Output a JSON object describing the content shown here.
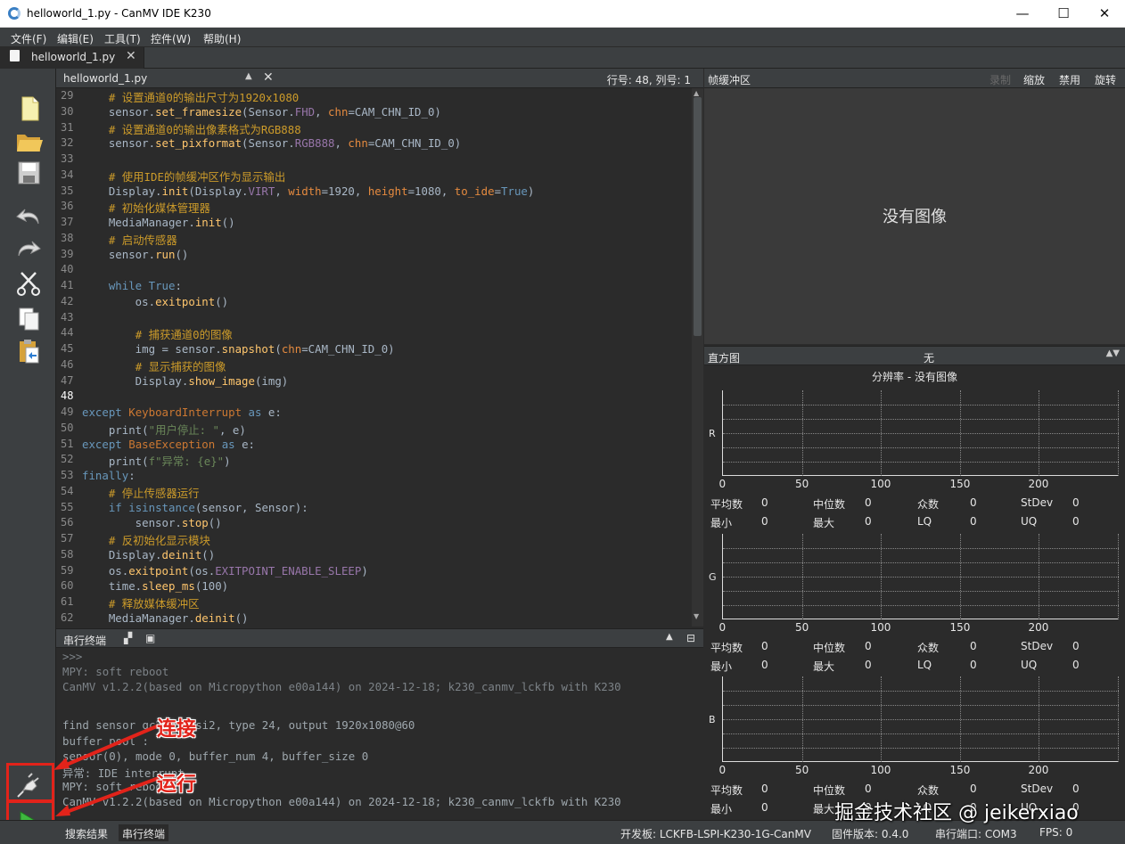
{
  "window": {
    "title": "helloworld_1.py - CanMV IDE K230",
    "minimize": "—",
    "maximize": "☐",
    "close": "✕"
  },
  "menu": [
    "文件(F)",
    "编辑(E)",
    "工具(T)",
    "控件(W)",
    "帮助(H)"
  ],
  "doc_tab": {
    "name": "helloworld_1.py",
    "close": "✕"
  },
  "editor": {
    "file": "helloworld_1.py",
    "position": "行号: 48, 列号: 1",
    "current_line": 48,
    "line_numbers": [
      "29",
      "30",
      "31",
      "32",
      "33",
      "34",
      "35",
      "36",
      "37",
      "38",
      "39",
      "40",
      "41",
      "42",
      "43",
      "44",
      "45",
      "46",
      "47",
      "48",
      "49",
      "50",
      "51",
      "52",
      "53",
      "54",
      "55",
      "56",
      "57",
      "58",
      "59",
      "60",
      "61",
      "62"
    ],
    "lines": [
      "    # 设置通道0的输出尺寸为1920x1080",
      "    sensor.set_framesize(Sensor.FHD, chn=CAM_CHN_ID_0)",
      "    # 设置通道0的输出像素格式为RGB888",
      "    sensor.set_pixformat(Sensor.RGB888, chn=CAM_CHN_ID_0)",
      "",
      "    # 使用IDE的帧缓冲区作为显示输出",
      "    Display.init(Display.VIRT, width=1920, height=1080, to_ide=True)",
      "    # 初始化媒体管理器",
      "    MediaManager.init()",
      "    # 启动传感器",
      "    sensor.run()",
      "",
      "    while True:",
      "        os.exitpoint()",
      "",
      "        # 捕获通道0的图像",
      "        img = sensor.snapshot(chn=CAM_CHN_ID_0)",
      "        # 显示捕获的图像",
      "        Display.show_image(img)",
      "",
      "except KeyboardInterrupt as e:",
      "    print(\"用户停止: \", e)",
      "except BaseException as e:",
      "    print(f\"异常: {e}\")",
      "finally:",
      "    # 停止传感器运行",
      "    if isinstance(sensor, Sensor):",
      "        sensor.stop()",
      "    # 反初始化显示模块",
      "    Display.deinit()",
      "    os.exitpoint(os.EXITPOINT_ENABLE_SLEEP)",
      "    time.sleep_ms(100)",
      "    # 释放媒体缓冲区",
      "    MediaManager.deinit()"
    ]
  },
  "terminal": {
    "title": "串行终端",
    "lines": [
      ">>>",
      "MPY: soft reboot",
      "CanMV v1.2.2(based on Micropython e00a144) on 2024-12-18; k230_canmv_lckfb with K230",
      "",
      "find sensor gc2093_csi2, type 24, output 1920x1080@60",
      "buffer pool :",
      "sensor(0), mode 0, buffer_num 4, buffer_size 0",
      "异常: IDE interrupt",
      "MPY: soft reboot",
      "CanMV v1.2.2(based on Micropython e00a144) on 2024-12-18; k230_canmv_lckfb with K230"
    ]
  },
  "framebuffer": {
    "title": "帧缓冲区",
    "buttons": [
      "录制",
      "缩放",
      "禁用",
      "旋转"
    ],
    "empty": "没有图像"
  },
  "histogram": {
    "title": "直方图",
    "mode": "无",
    "resolution": "分辨率 - 没有图像",
    "ticks": [
      "0",
      "50",
      "100",
      "150",
      "200"
    ],
    "channels": [
      {
        "label": "R",
        "stats": [
          [
            "平均数",
            "0"
          ],
          [
            "中位数",
            "0"
          ],
          [
            "众数",
            "0"
          ],
          [
            "StDev",
            "0"
          ],
          [
            "最小",
            "0"
          ],
          [
            "最大",
            "0"
          ],
          [
            "LQ",
            "0"
          ],
          [
            "UQ",
            "0"
          ]
        ]
      },
      {
        "label": "G",
        "stats": [
          [
            "平均数",
            "0"
          ],
          [
            "中位数",
            "0"
          ],
          [
            "众数",
            "0"
          ],
          [
            "StDev",
            "0"
          ],
          [
            "最小",
            "0"
          ],
          [
            "最大",
            "0"
          ],
          [
            "LQ",
            "0"
          ],
          [
            "UQ",
            "0"
          ]
        ]
      },
      {
        "label": "B",
        "stats": [
          [
            "平均数",
            "0"
          ],
          [
            "中位数",
            "0"
          ],
          [
            "众数",
            "0"
          ],
          [
            "StDev",
            "0"
          ],
          [
            "最小",
            "0"
          ],
          [
            "最大",
            "0"
          ],
          [
            "LQ",
            "0"
          ],
          [
            "UQ",
            "0"
          ]
        ]
      }
    ]
  },
  "bottom_tabs": [
    "搜索结果",
    "串行终端"
  ],
  "status": {
    "board": "开发板:  LCKFB-LSPI-K230-1G-CanMV",
    "firmware": "固件版本:  0.4.0",
    "port": "串行端口:  COM3",
    "fps": "FPS:  0"
  },
  "annotations": {
    "connect": "连接",
    "run": "运行",
    "color": "#e2231a"
  },
  "watermark": "掘金技术社区 @ jeikerxiao",
  "icons": [
    "new-file-icon",
    "open-folder-icon",
    "save-icon",
    "undo-icon",
    "redo-icon",
    "cut-icon",
    "copy-icon",
    "paste-icon",
    "connect-plug-icon",
    "run-play-icon"
  ]
}
